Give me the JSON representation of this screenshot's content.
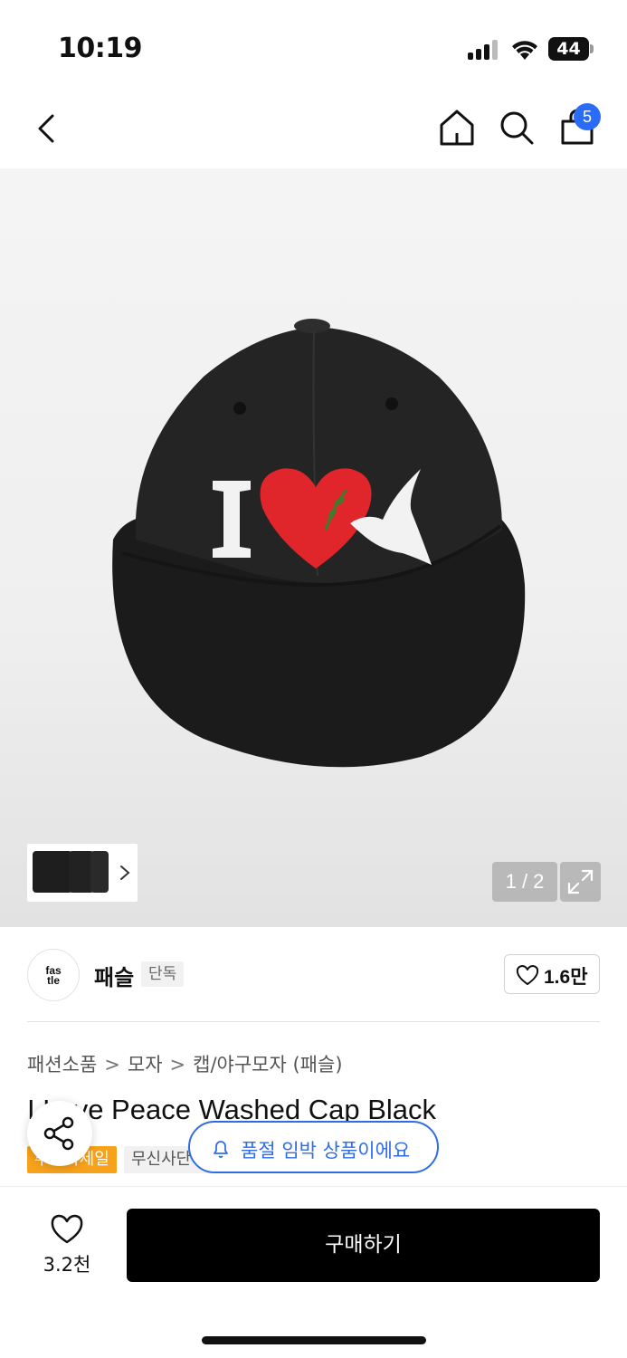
{
  "status_bar": {
    "time": "10:19",
    "battery": "44"
  },
  "header": {
    "back_icon": "chevron-left-icon",
    "home_icon": "home-icon",
    "search_icon": "search-icon",
    "cart_icon": "shopping-bag-icon",
    "cart_count": "5"
  },
  "gallery": {
    "page_indicator": "1 / 2",
    "expand_icon": "expand-icon",
    "thumbnail_arrow_icon": "chevron-right-icon"
  },
  "brand": {
    "logo_text_line1": "fas",
    "logo_text_line2": "tle",
    "name": "패슬",
    "tag": "단독",
    "like_count": "1.6만"
  },
  "product": {
    "breadcrumb": [
      "패션소품",
      "모자",
      "캡/야구모자 (패슬)"
    ],
    "title": "I Love Peace Washed Cap Black",
    "tags": [
      "추석특세일",
      "무신사단독"
    ]
  },
  "floating": {
    "share_icon": "share-icon",
    "toast_text": "품절 임박 상품이에요",
    "toast_icon": "bell-icon"
  },
  "bottom_bar": {
    "wish_count": "3.2천",
    "buy_label": "구매하기"
  },
  "colors": {
    "accent_blue": "#2f6de8",
    "cart_badge": "#2b6cf6",
    "sale_tag": "#f7a21b",
    "buy_button": "#000000"
  }
}
